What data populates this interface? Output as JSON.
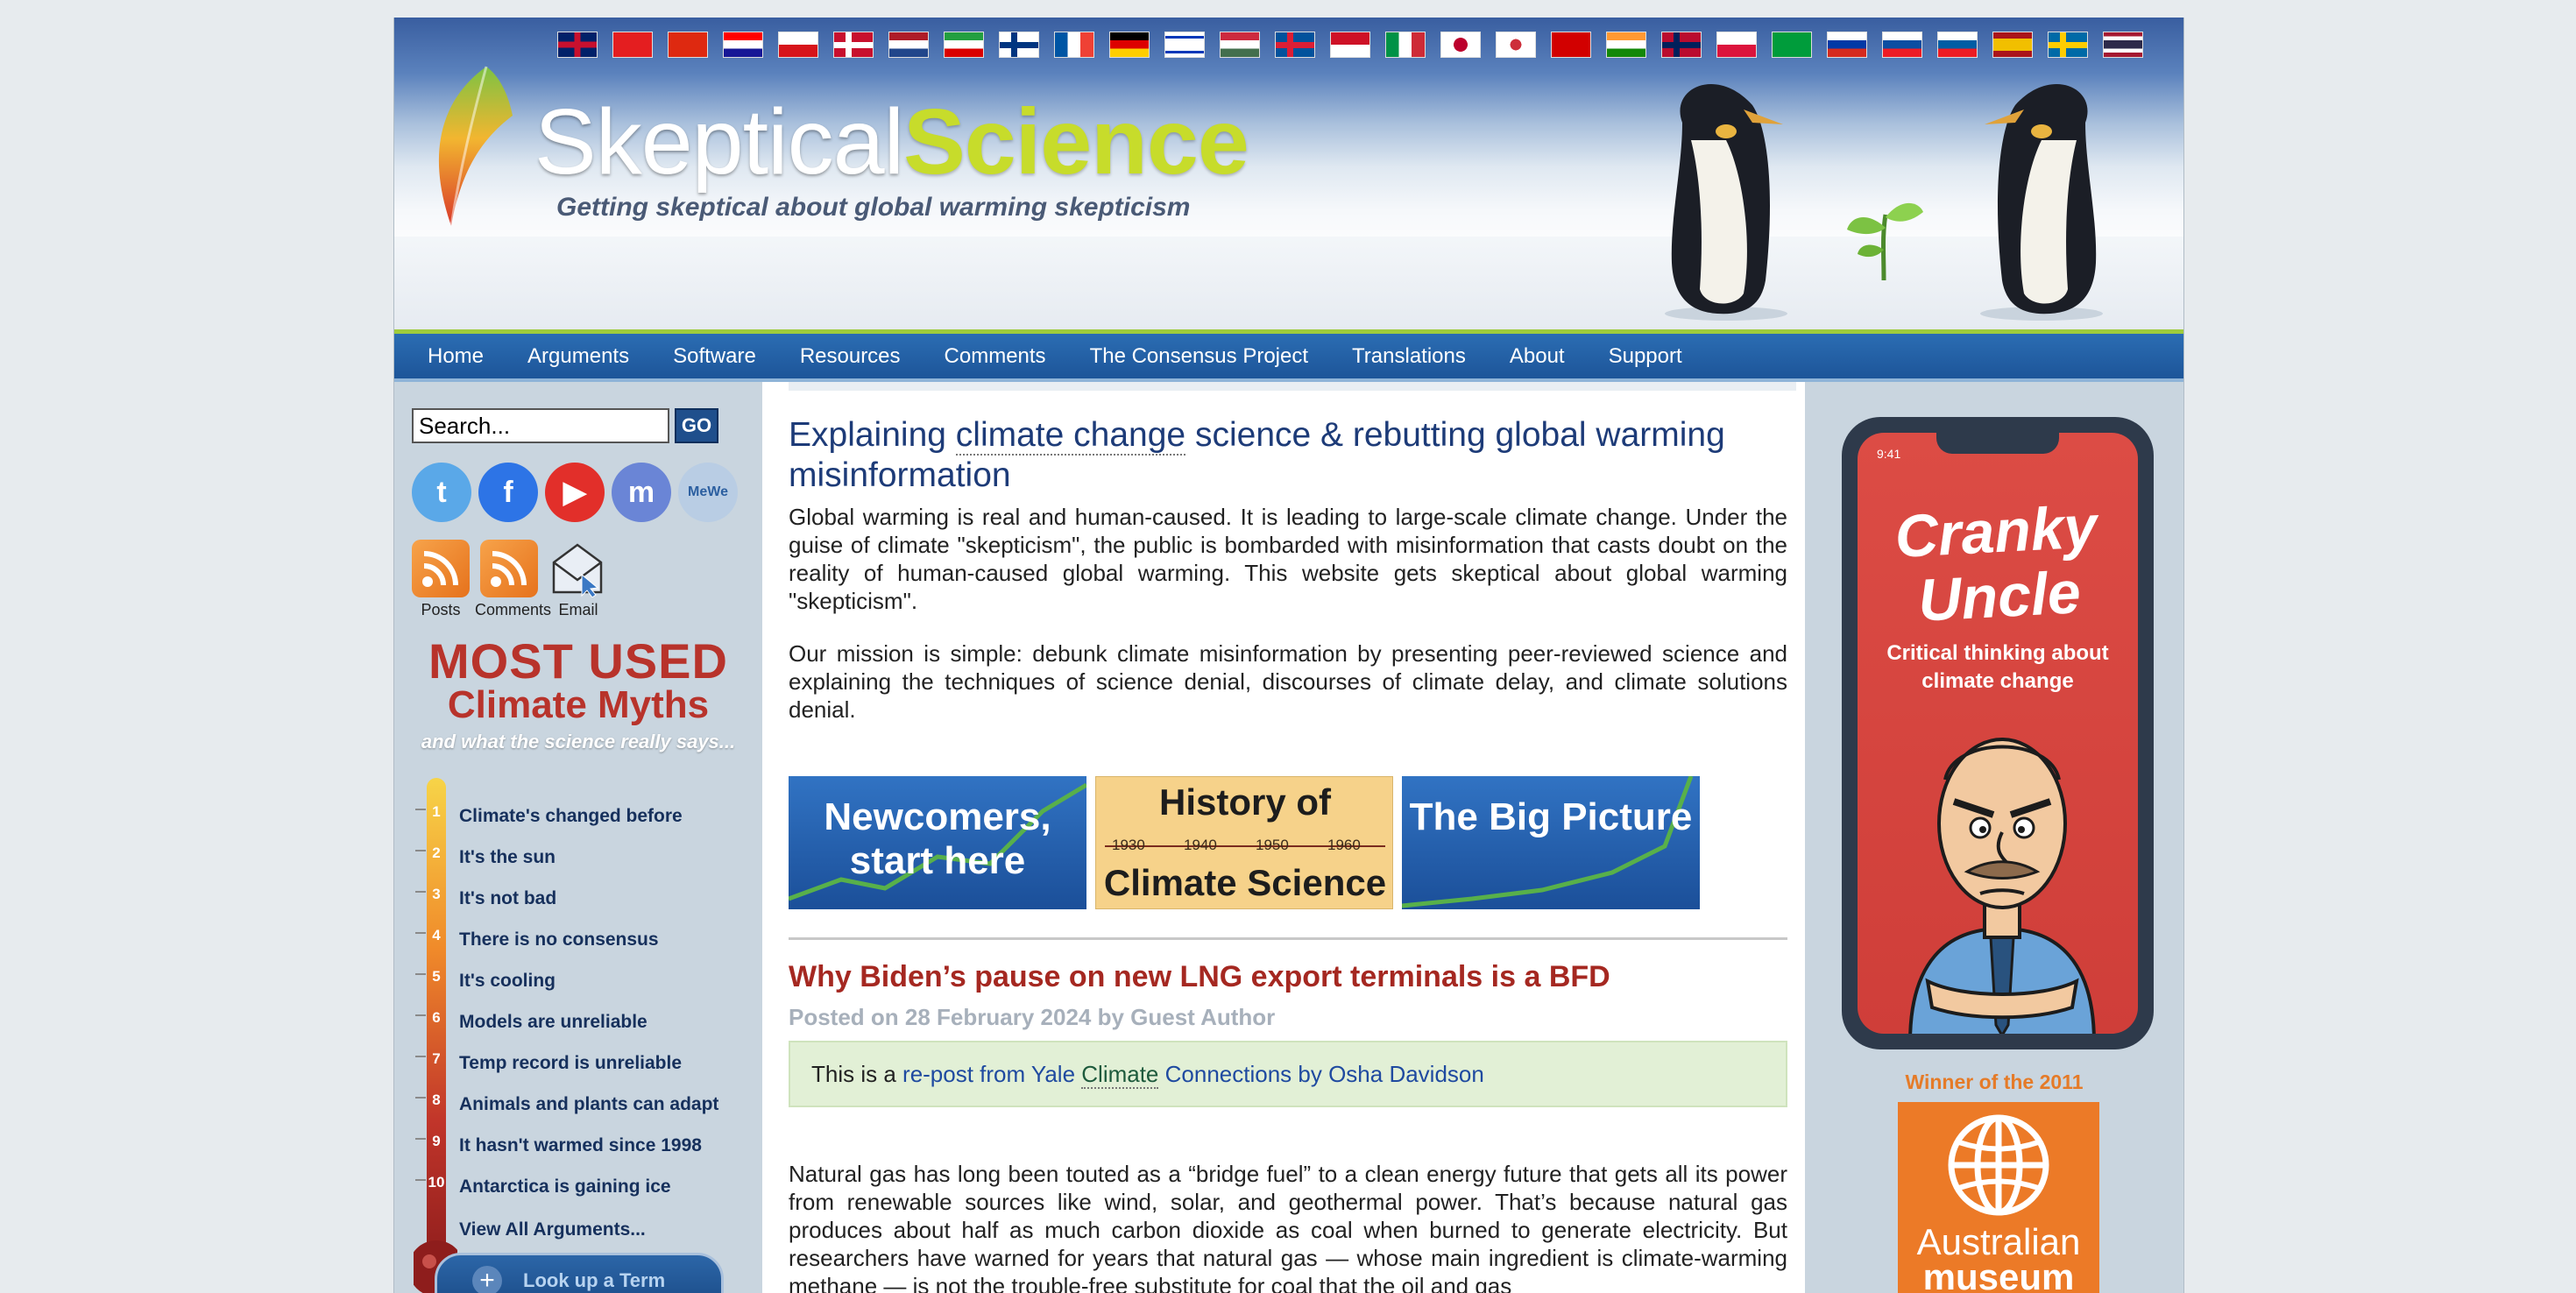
{
  "site": {
    "name_part1": "Skeptical",
    "name_part2": "Science",
    "tagline": "Getting skeptical about global warming skepticism"
  },
  "languages": [
    "gb",
    "al",
    "cn",
    "hr",
    "cz",
    "dk",
    "nl",
    "ir",
    "fi",
    "fr",
    "de",
    "il",
    "hu",
    "is",
    "id",
    "it",
    "jp",
    "kr",
    "mk",
    "in",
    "no",
    "pl",
    "br",
    "ru",
    "sk",
    "si",
    "es",
    "se",
    "th"
  ],
  "nav": [
    "Home",
    "Arguments",
    "Software",
    "Resources",
    "Comments",
    "The Consensus Project",
    "Translations",
    "About",
    "Support"
  ],
  "search": {
    "value": "Search...",
    "go": "GO"
  },
  "social": [
    {
      "name": "twitter-icon",
      "color": "#5aa8e8",
      "glyph": "t"
    },
    {
      "name": "facebook-icon",
      "color": "#2d74e6",
      "glyph": "f"
    },
    {
      "name": "youtube-icon",
      "color": "#e22f2a",
      "glyph": "▶"
    },
    {
      "name": "mastodon-icon",
      "color": "#6a85d6",
      "glyph": "m"
    },
    {
      "name": "mewe-icon",
      "color": "#b9cde4",
      "glyph": "MeWe"
    }
  ],
  "feeds": {
    "posts": "Posts",
    "comments": "Comments",
    "email": "Email"
  },
  "myths": {
    "title_line1": "MOST USED",
    "title_line2": "Climate Myths",
    "subtitle": "and what the science really says...",
    "items": [
      {
        "num": "1",
        "label": "Climate's changed before"
      },
      {
        "num": "2",
        "label": "It's the sun"
      },
      {
        "num": "3",
        "label": "It's not bad"
      },
      {
        "num": "4",
        "label": "There is no consensus"
      },
      {
        "num": "5",
        "label": "It's cooling"
      },
      {
        "num": "6",
        "label": "Models are unreliable"
      },
      {
        "num": "7",
        "label": "Temp record is unreliable"
      },
      {
        "num": "8",
        "label": "Animals and plants can adapt"
      },
      {
        "num": "9",
        "label": "It hasn't warmed since 1998"
      },
      {
        "num": "10",
        "label": "Antarctica is gaining ice"
      }
    ],
    "view_all": "View All Arguments..."
  },
  "lookup": "Look up a Term",
  "main": {
    "heading_pre": "Explaining ",
    "heading_link": "climate change",
    "heading_post": " science & rebutting global warming misinformation",
    "para1": "Global warming is real and human-caused. It is leading to large-scale climate change. Under the guise of climate \"skepticism\", the public is bombarded with misinformation that casts doubt on the reality of human-caused global warming. This website gets skeptical about global warming \"skepticism\".",
    "para2": "Our mission is simple: debunk climate misinformation by presenting peer-reviewed science and explaining the techniques of science denial, discourses of climate delay, and climate solutions denial.",
    "banners": {
      "newcomers": "Newcomers, start here",
      "history_top": "History of",
      "history_bottom": "Climate Science",
      "history_years": [
        "1930",
        "1940",
        "1950",
        "1960"
      ],
      "big_picture": "The Big Picture"
    },
    "post": {
      "title": "Why Biden’s pause on new LNG export terminals is a BFD",
      "meta": "Posted on 28 February 2024 by Guest Author",
      "repost_pre": "This is a ",
      "repost_link1": "re-post from Yale ",
      "repost_climate": "Climate",
      "repost_link2": " Connections by Osha Davidson",
      "body": "Natural gas has long been touted as a “bridge fuel” to a clean energy future that gets all its power from renewable sources like wind, solar, and geothermal power. That’s because natural gas produces about half as much carbon dioxide as coal when burned to generate electricity. But researchers have warned for years that natural gas — whose main ingredient is climate-warming methane — is not the trouble-free substitute for coal that the oil and gas"
    }
  },
  "right": {
    "phone_time": "9:41",
    "cu_line1": "Cranky",
    "cu_line2": "Uncle",
    "cu_sub": "Critical thinking about climate change",
    "winner": "Winner of the 2011",
    "museum_line1": "Australian",
    "museum_line2": "museum"
  },
  "colors": {
    "nav_bg": "#1d5599",
    "heading_blue": "#1d3b78",
    "post_red": "#a52821",
    "myth_red": "#b8332b",
    "science_green": "#c7dc2b"
  }
}
